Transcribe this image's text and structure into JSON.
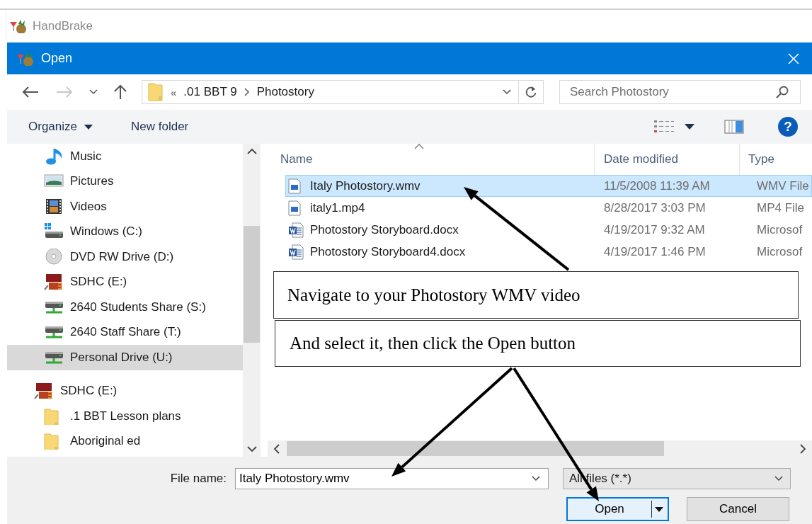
{
  "app": {
    "title": "HandBrake"
  },
  "window": {
    "title": "Open"
  },
  "address": {
    "overflow": "«",
    "segments": [
      ".01 BBT 9",
      "Photostory"
    ]
  },
  "search": {
    "placeholder": "Search Photostory"
  },
  "toolbar": {
    "buttons": [
      {
        "label": "Organize",
        "dropdown": true
      },
      {
        "label": "New folder",
        "dropdown": false
      }
    ],
    "help": "?"
  },
  "sidebar": {
    "items": [
      {
        "label": "Music",
        "kind": "music",
        "selected": false
      },
      {
        "label": "Pictures",
        "kind": "pictures",
        "selected": false
      },
      {
        "label": "Videos",
        "kind": "videos",
        "selected": false
      },
      {
        "label": "Windows (C:)",
        "kind": "local_disk",
        "selected": false
      },
      {
        "label": "DVD RW Drive (D:)",
        "kind": "dvd",
        "selected": false
      },
      {
        "label": "SDHC (E:)",
        "kind": "sd_card",
        "selected": false
      },
      {
        "label": "2640 Students Share (S:)",
        "kind": "network",
        "selected": false
      },
      {
        "label": "2640 Staff Share (T:)",
        "kind": "network",
        "selected": false
      },
      {
        "label": "Personal Drive (U:)",
        "kind": "network",
        "selected": true
      }
    ],
    "tree": [
      {
        "label": "SDHC (E:)",
        "kind": "sd_card",
        "selected": false,
        "children": [
          {
            "label": ".1 BBT Lesson plans",
            "kind": "folder",
            "selected": false
          },
          {
            "label": "Aboriginal ed",
            "kind": "folder",
            "selected": false
          }
        ]
      }
    ]
  },
  "table": {
    "columns": [
      {
        "label": "Name",
        "sorted": true
      },
      {
        "label": "Date modified",
        "sorted": false
      },
      {
        "label": "Type",
        "sorted": false
      }
    ],
    "rows": [
      {
        "name": "Italy Photostory.wmv",
        "date": "11/5/2008 11:39 AM",
        "type": "WMV File",
        "kind": "video",
        "selected": true
      },
      {
        "name": "italy1.mp4",
        "date": "8/28/2017 3:03 PM",
        "type": "MP4 File",
        "kind": "video",
        "selected": false
      },
      {
        "name": "Photostory Storyboard.docx",
        "date": "4/19/2017 9:32 AM",
        "type": "Microsof",
        "kind": "word",
        "selected": false
      },
      {
        "name": "Photostory Storyboard4.docx",
        "date": "4/19/2017 1:46 PM",
        "type": "Microsof",
        "kind": "word",
        "selected": false
      }
    ]
  },
  "file_name": {
    "label": "File name:",
    "value": "Italy Photostory.wmv"
  },
  "file_type": {
    "value": "All files (*.*)"
  },
  "buttons": [
    {
      "label": "Open",
      "kind": "split"
    },
    {
      "label": "Cancel",
      "kind": "plain"
    }
  ],
  "annotations": [
    {
      "text": "Navigate to your Photostory WMV video"
    },
    {
      "text": "And select it, then click the Open button"
    }
  ]
}
